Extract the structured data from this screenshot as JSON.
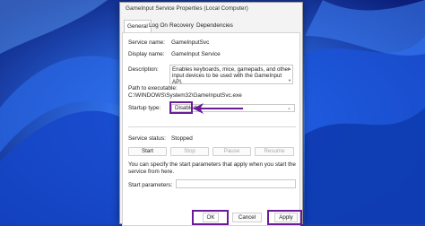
{
  "dialog": {
    "title": "GameInput Service Properties (Local Computer)"
  },
  "tabs": [
    "General",
    "Log On",
    "Recovery",
    "Dependencies"
  ],
  "general": {
    "service_name_label": "Service name:",
    "service_name": "GameInputSvc",
    "display_name_label": "Display name:",
    "display_name": "GameInput Service",
    "description_label": "Description:",
    "description": "Enables keyboards, mice, gamepads, and other input devices to be used with the GameInput API.",
    "path_label": "Path to executable:",
    "path": "C:\\WINDOWS\\System32\\GameInputSvc.exe",
    "startup_type_label": "Startup type:",
    "startup_type": "Disabled",
    "service_status_label": "Service status:",
    "service_status": "Stopped",
    "buttons": {
      "start": "Start",
      "stop": "Stop",
      "pause": "Pause",
      "resume": "Resume"
    },
    "hint": "You can specify the start parameters that apply when you start the service from here.",
    "start_params_label": "Start parameters:",
    "start_params_value": ""
  },
  "footer": {
    "ok": "OK",
    "cancel": "Cancel",
    "apply": "Apply"
  },
  "colors": {
    "highlight": "#6a1b9a",
    "wallpaper": "#1b3fae"
  }
}
